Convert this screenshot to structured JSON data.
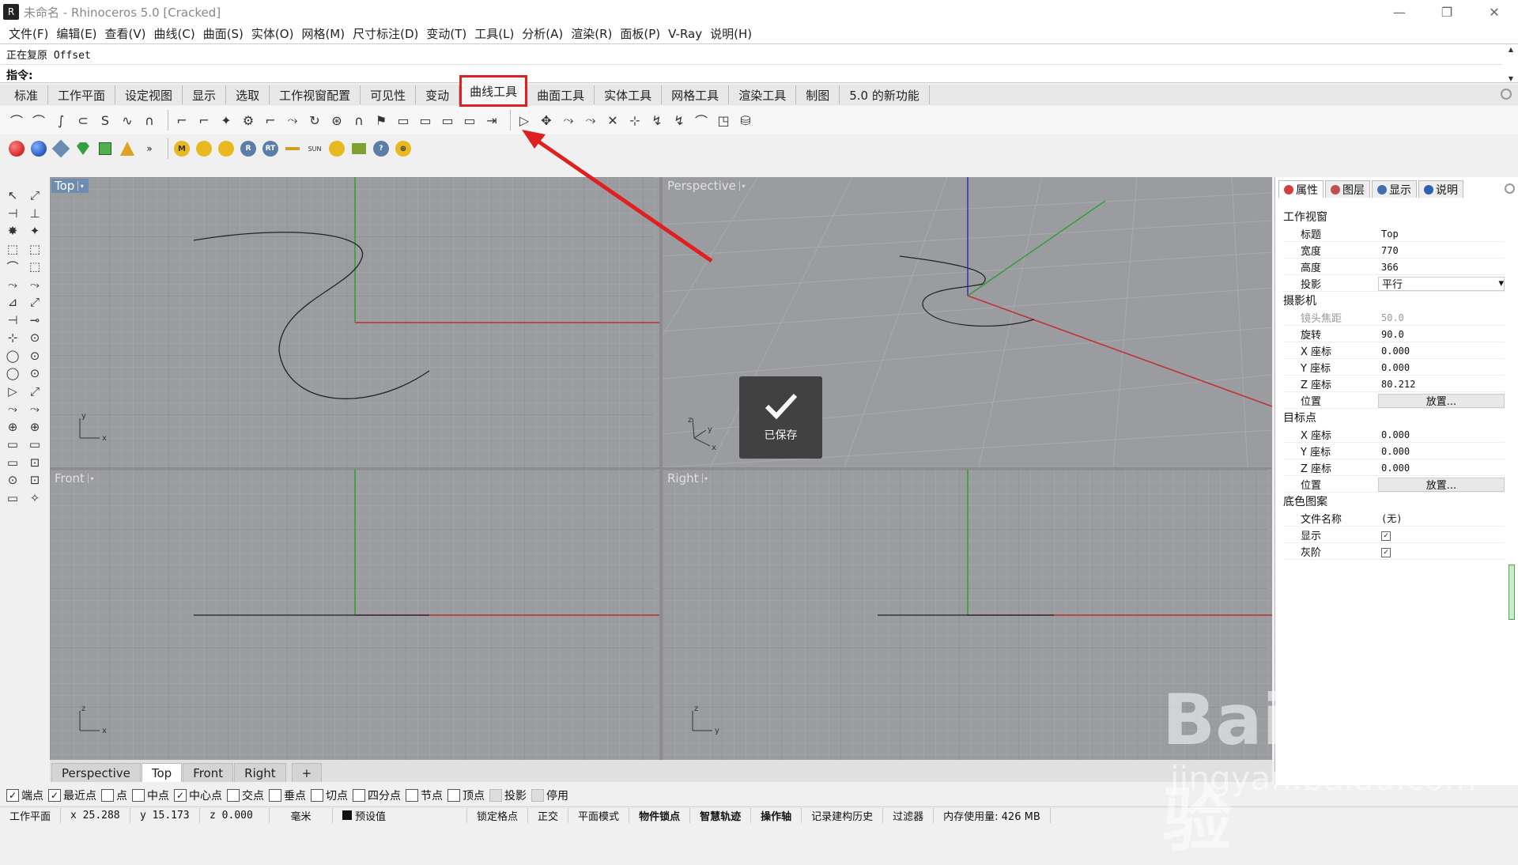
{
  "window": {
    "title": "未命名 - Rhinoceros 5.0 [Cracked]"
  },
  "menu": [
    "文件(F)",
    "编辑(E)",
    "查看(V)",
    "曲线(C)",
    "曲面(S)",
    "实体(O)",
    "网格(M)",
    "尺寸标注(D)",
    "变动(T)",
    "工具(L)",
    "分析(A)",
    "渲染(R)",
    "面板(P)",
    "V-Ray",
    "说明(H)"
  ],
  "command": {
    "history": "正在复原 Offset",
    "prompt": "指令:"
  },
  "toolbar_tabs": [
    "标准",
    "工作平面",
    "设定视图",
    "显示",
    "选取",
    "工作视窗配置",
    "可见性",
    "变动",
    "曲线工具",
    "曲面工具",
    "实体工具",
    "网格工具",
    "渲染工具",
    "制图",
    "5.0 的新功能"
  ],
  "active_tab": "曲线工具",
  "render_tools": [
    "M",
    "R",
    "RT",
    "SUN"
  ],
  "viewports": {
    "top": "Top",
    "perspective": "Perspective",
    "front": "Front",
    "right": "Right"
  },
  "viewport_tabs": [
    "Perspective",
    "Top",
    "Front",
    "Right"
  ],
  "toast": {
    "label": "已保存"
  },
  "panel": {
    "tabs": [
      "属性",
      "图层",
      "显示",
      "说明"
    ],
    "sections": {
      "viewport": "工作视窗",
      "camera": "摄影机",
      "target": "目标点",
      "background": "底色图案"
    },
    "viewport_props": [
      {
        "k": "标题",
        "v": "Top"
      },
      {
        "k": "宽度",
        "v": "770"
      },
      {
        "k": "高度",
        "v": "366"
      },
      {
        "k": "投影",
        "v": "平行"
      }
    ],
    "camera_props": [
      {
        "k": "镜头焦距",
        "v": "50.0"
      },
      {
        "k": "旋转",
        "v": "90.0"
      },
      {
        "k": "X 座标",
        "v": "0.000"
      },
      {
        "k": "Y 座标",
        "v": "0.000"
      },
      {
        "k": "Z 座标",
        "v": "80.212"
      },
      {
        "k": "位置",
        "v": "放置..."
      }
    ],
    "target_props": [
      {
        "k": "X 座标",
        "v": "0.000"
      },
      {
        "k": "Y 座标",
        "v": "0.000"
      },
      {
        "k": "Z 座标",
        "v": "0.000"
      },
      {
        "k": "位置",
        "v": "放置..."
      }
    ],
    "background_props": [
      {
        "k": "文件名称",
        "v": "(无)"
      },
      {
        "k": "显示",
        "v": "✓"
      },
      {
        "k": "灰阶",
        "v": "✓"
      }
    ]
  },
  "osnaps": [
    {
      "label": "端点",
      "checked": true
    },
    {
      "label": "最近点",
      "checked": true
    },
    {
      "label": "点",
      "checked": false
    },
    {
      "label": "中点",
      "checked": false
    },
    {
      "label": "中心点",
      "checked": true
    },
    {
      "label": "交点",
      "checked": false
    },
    {
      "label": "垂点",
      "checked": false
    },
    {
      "label": "切点",
      "checked": false
    },
    {
      "label": "四分点",
      "checked": false
    },
    {
      "label": "节点",
      "checked": false
    },
    {
      "label": "顶点",
      "checked": false
    },
    {
      "label": "投影",
      "checked": false,
      "disabled": true
    },
    {
      "label": "停用",
      "checked": false,
      "disabled": true
    }
  ],
  "status": {
    "cplane": "工作平面",
    "x": "x 25.288",
    "y": "y 15.173",
    "z": "z 0.000",
    "unit": "毫米",
    "layer": "预设值",
    "items": [
      "锁定格点",
      "正交",
      "平面模式",
      "物件锁点",
      "智慧轨迹",
      "操作轴",
      "记录建构历史",
      "过滤器"
    ],
    "bold_items": [
      "物件锁点",
      "智慧轨迹",
      "操作轴"
    ],
    "memory": "内存使用量: 426 MB"
  },
  "watermark": {
    "logo": "Baidu经验",
    "url": "jingyan.baidu.com"
  },
  "colors": {
    "highlight": "#e02020",
    "viewport_bg": "#9a9ca0",
    "x_axis": "#c03030",
    "y_axis": "#30a030",
    "z_axis": "#3030c0"
  }
}
